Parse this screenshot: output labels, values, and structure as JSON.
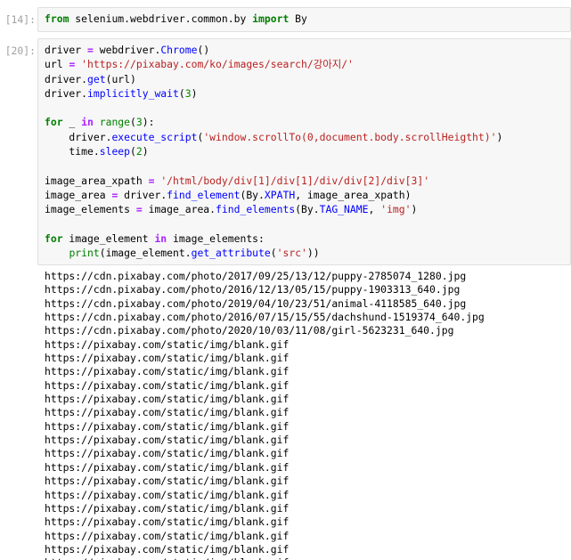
{
  "cell14": {
    "prompt": "[14]:",
    "code": [
      [
        {
          "t": "from",
          "c": "kw"
        },
        {
          "t": " selenium.webdriver.common.by ",
          "c": ""
        },
        {
          "t": "import",
          "c": "kw"
        },
        {
          "t": " By",
          "c": ""
        }
      ]
    ]
  },
  "cell20": {
    "prompt": "[20]:",
    "code": [
      [
        {
          "t": "driver ",
          "c": ""
        },
        {
          "t": "=",
          "c": "op"
        },
        {
          "t": " webdriver",
          "c": ""
        },
        {
          "t": ".",
          "c": ""
        },
        {
          "t": "Chrome",
          "c": "fn"
        },
        {
          "t": "()",
          "c": ""
        }
      ],
      [
        {
          "t": "url ",
          "c": ""
        },
        {
          "t": "=",
          "c": "op"
        },
        {
          "t": " ",
          "c": ""
        },
        {
          "t": "'https://pixabay.com/ko/images/search/강아지/'",
          "c": "str"
        }
      ],
      [
        {
          "t": "driver",
          "c": ""
        },
        {
          "t": ".",
          "c": ""
        },
        {
          "t": "get",
          "c": "fn"
        },
        {
          "t": "(url)",
          "c": ""
        }
      ],
      [
        {
          "t": "driver",
          "c": ""
        },
        {
          "t": ".",
          "c": ""
        },
        {
          "t": "implicitly_wait",
          "c": "fn"
        },
        {
          "t": "(",
          "c": ""
        },
        {
          "t": "3",
          "c": "num"
        },
        {
          "t": ")",
          "c": ""
        }
      ],
      [],
      [
        {
          "t": "for",
          "c": "kw"
        },
        {
          "t": " _ ",
          "c": ""
        },
        {
          "t": "in",
          "c": "op"
        },
        {
          "t": " ",
          "c": ""
        },
        {
          "t": "range",
          "c": "bi"
        },
        {
          "t": "(",
          "c": ""
        },
        {
          "t": "3",
          "c": "num"
        },
        {
          "t": "):",
          "c": ""
        }
      ],
      [
        {
          "t": "    driver",
          "c": ""
        },
        {
          "t": ".",
          "c": ""
        },
        {
          "t": "execute_script",
          "c": "fn"
        },
        {
          "t": "(",
          "c": ""
        },
        {
          "t": "'window.scrollTo(0,document.body.scrollHeigtht)'",
          "c": "str"
        },
        {
          "t": ")",
          "c": ""
        }
      ],
      [
        {
          "t": "    time",
          "c": ""
        },
        {
          "t": ".",
          "c": ""
        },
        {
          "t": "sleep",
          "c": "fn"
        },
        {
          "t": "(",
          "c": ""
        },
        {
          "t": "2",
          "c": "num"
        },
        {
          "t": ")",
          "c": ""
        }
      ],
      [],
      [
        {
          "t": "image_area_xpath ",
          "c": ""
        },
        {
          "t": "=",
          "c": "op"
        },
        {
          "t": " ",
          "c": ""
        },
        {
          "t": "'/html/body/div[1]/div[1]/div/div[2]/div[3]'",
          "c": "str"
        }
      ],
      [
        {
          "t": "image_area ",
          "c": ""
        },
        {
          "t": "=",
          "c": "op"
        },
        {
          "t": " driver",
          "c": ""
        },
        {
          "t": ".",
          "c": ""
        },
        {
          "t": "find_element",
          "c": "fn"
        },
        {
          "t": "(By",
          "c": ""
        },
        {
          "t": ".",
          "c": ""
        },
        {
          "t": "XPATH",
          "c": "fn"
        },
        {
          "t": ", image_area_xpath)",
          "c": ""
        }
      ],
      [
        {
          "t": "image_elements ",
          "c": ""
        },
        {
          "t": "=",
          "c": "op"
        },
        {
          "t": " image_area",
          "c": ""
        },
        {
          "t": ".",
          "c": ""
        },
        {
          "t": "find_elements",
          "c": "fn"
        },
        {
          "t": "(By",
          "c": ""
        },
        {
          "t": ".",
          "c": ""
        },
        {
          "t": "TAG_NAME",
          "c": "fn"
        },
        {
          "t": ", ",
          "c": ""
        },
        {
          "t": "'img'",
          "c": "str"
        },
        {
          "t": ")",
          "c": ""
        }
      ],
      [],
      [
        {
          "t": "for",
          "c": "kw"
        },
        {
          "t": " image_element ",
          "c": ""
        },
        {
          "t": "in",
          "c": "op"
        },
        {
          "t": " image_elements:",
          "c": ""
        }
      ],
      [
        {
          "t": "    ",
          "c": ""
        },
        {
          "t": "print",
          "c": "bi"
        },
        {
          "t": "(image_element",
          "c": ""
        },
        {
          "t": ".",
          "c": ""
        },
        {
          "t": "get_attribute",
          "c": "fn"
        },
        {
          "t": "(",
          "c": ""
        },
        {
          "t": "'src'",
          "c": "str"
        },
        {
          "t": "))",
          "c": ""
        }
      ]
    ],
    "output": [
      "https://cdn.pixabay.com/photo/2017/09/25/13/12/puppy-2785074_1280.jpg",
      "https://cdn.pixabay.com/photo/2016/12/13/05/15/puppy-1903313_640.jpg",
      "https://cdn.pixabay.com/photo/2019/04/10/23/51/animal-4118585_640.jpg",
      "https://cdn.pixabay.com/photo/2016/07/15/15/55/dachshund-1519374_640.jpg",
      "https://cdn.pixabay.com/photo/2020/10/03/11/08/girl-5623231_640.jpg",
      "https://pixabay.com/static/img/blank.gif",
      "https://pixabay.com/static/img/blank.gif",
      "https://pixabay.com/static/img/blank.gif",
      "https://pixabay.com/static/img/blank.gif",
      "https://pixabay.com/static/img/blank.gif",
      "https://pixabay.com/static/img/blank.gif",
      "https://pixabay.com/static/img/blank.gif",
      "https://pixabay.com/static/img/blank.gif",
      "https://pixabay.com/static/img/blank.gif",
      "https://pixabay.com/static/img/blank.gif",
      "https://pixabay.com/static/img/blank.gif",
      "https://pixabay.com/static/img/blank.gif",
      "https://pixabay.com/static/img/blank.gif",
      "https://pixabay.com/static/img/blank.gif",
      "https://pixabay.com/static/img/blank.gif",
      "https://pixabay.com/static/img/blank.gif",
      "https://pixabay.com/static/img/blank.gif"
    ]
  }
}
